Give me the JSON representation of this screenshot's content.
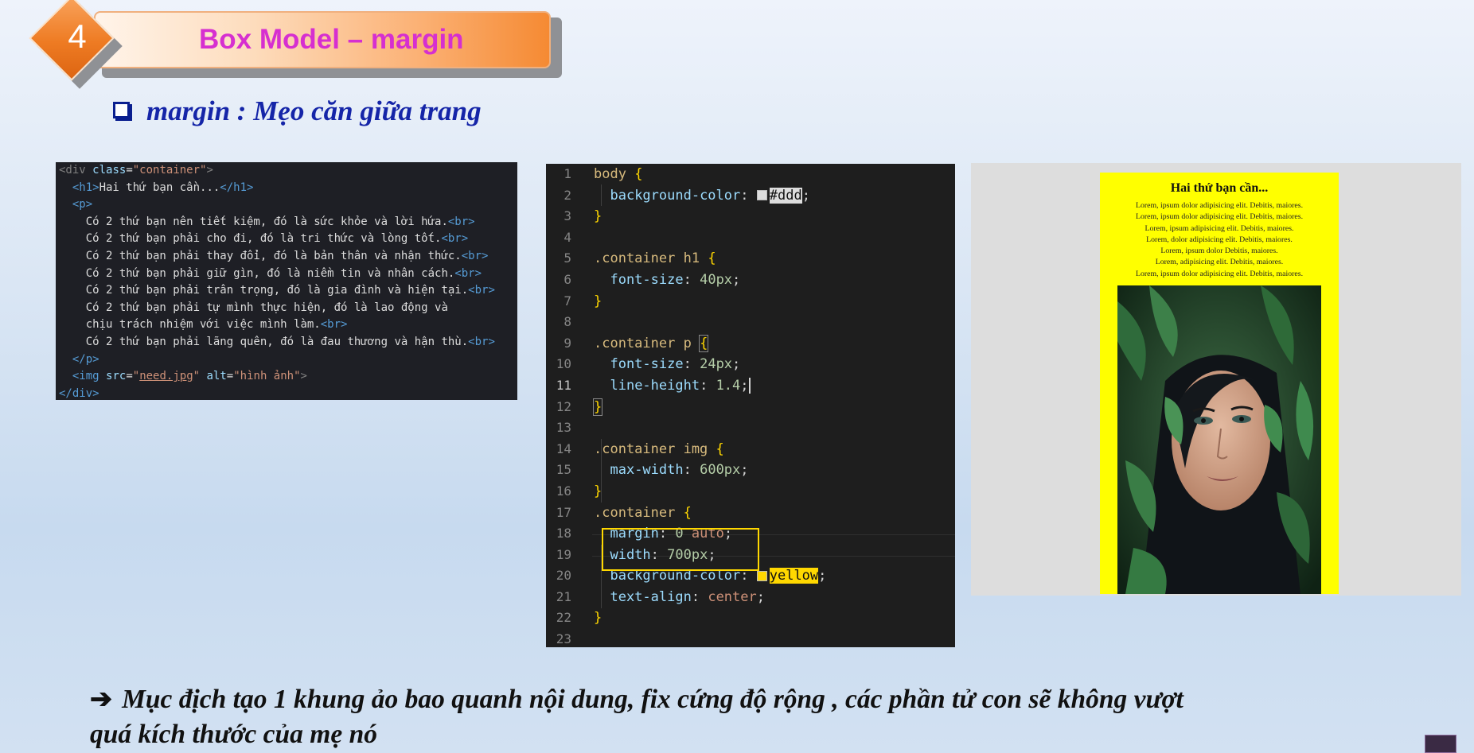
{
  "header": {
    "number": "4",
    "title": "Box Model – margin"
  },
  "subtitle": "margin : Mẹo căn giữa trang",
  "html_code": {
    "line1_open": "<div ",
    "line1_attr": "class",
    "line1_eq": "=",
    "line1_val": "\"container\"",
    "line1_close": ">",
    "h1_open": "<h1>",
    "h1_text": "Hai thứ bạn cần...",
    "h1_close": "</h1>",
    "p_open": "<p>",
    "p_lines": [
      "Có 2 thứ bạn nên tiết kiệm, đó là sức khỏe và lời hứa.",
      "Có 2 thứ bạn phải cho đi, đó là tri thức và lòng tốt.",
      "Có 2 thứ bạn phải thay đổi, đó là bản thân và nhận thức.",
      "Có 2 thứ bạn phải giữ gìn, đó là niềm tin và nhân cách.",
      "Có 2 thứ bạn phải trân trọng, đó là gia đình và hiện tại.",
      "Có 2 thứ bạn phải tự mình thực hiện, đó là lao động và",
      "chịu trách nhiệm với việc mình làm.",
      "Có 2 thứ bạn phải lãng quên, đó là đau thương và hận thù."
    ],
    "br": "<br>",
    "p_close": "</p>",
    "img_open": "<img ",
    "img_src_attr": "src",
    "img_src_val": "need.jpg",
    "img_alt_attr": "alt",
    "img_alt_val": "\"hình ảnh\"",
    "img_close": ">",
    "div_close": "</div>"
  },
  "css_code": {
    "line_numbers": [
      "1",
      "2",
      "3",
      "4",
      "5",
      "6",
      "7",
      "8",
      "9",
      "10",
      "11",
      "12",
      "13",
      "14",
      "15",
      "16",
      "17",
      "18",
      "19",
      "20",
      "21",
      "22",
      "23"
    ],
    "active_line": "11",
    "body_sel": "body",
    "bg_prop": "background-color",
    "ddd_val": "#ddd",
    "h1_sel": ".container h1",
    "fs_prop": "font-size",
    "fs40": "40px",
    "p_sel": ".container p",
    "fs24": "24px",
    "lh_prop": "line-height",
    "lh_val": "1.4",
    "img_sel": ".container img",
    "mw_prop": "max-width",
    "mw_val": "600px",
    "c_sel": ".container",
    "margin_prop": "margin",
    "margin_num": "0",
    "margin_kw": "auto",
    "width_prop": "width",
    "width_val": "700px",
    "yellow_val": "yellow",
    "ta_prop": "text-align",
    "ta_val": "center",
    "open_brace": "{",
    "close_brace": "}",
    "colon": ": ",
    "semicolon": ";",
    "swatch_ddd": "#dddddd",
    "swatch_yellow": "#ffd800"
  },
  "preview": {
    "title": "Hai thứ bạn cần...",
    "lines": [
      "Lorem, ipsum dolor adipisicing elit. Debitis, maiores.",
      "Lorem, ipsum dolor adipisicing elit. Debitis, maiores.",
      "Lorem, ipsum adipisicing elit. Debitis, maiores.",
      "Lorem, dolor adipisicing elit. Debitis, maiores.",
      "Lorem, ipsum dolor Debitis, maiores.",
      "Lorem, adipisicing elit. Debitis, maiores.",
      "Lorem, ipsum dolor adipisicing elit. Debitis, maiores."
    ],
    "page_color": "#ffff00",
    "photo_icon": "portrait-photo"
  },
  "note": {
    "arrow_icon": "right-arrow-icon",
    "line1": "Mục địch tạo 1 khung ảo bao quanh nội dung, fix cứng độ rộng , các phần tử con sẽ không vượt",
    "line2": "quá kích thước của mẹ nó"
  },
  "colors": {
    "title_text": "#d62fd0",
    "diamond": "#ee7b23",
    "subtitle": "#1525a8"
  }
}
